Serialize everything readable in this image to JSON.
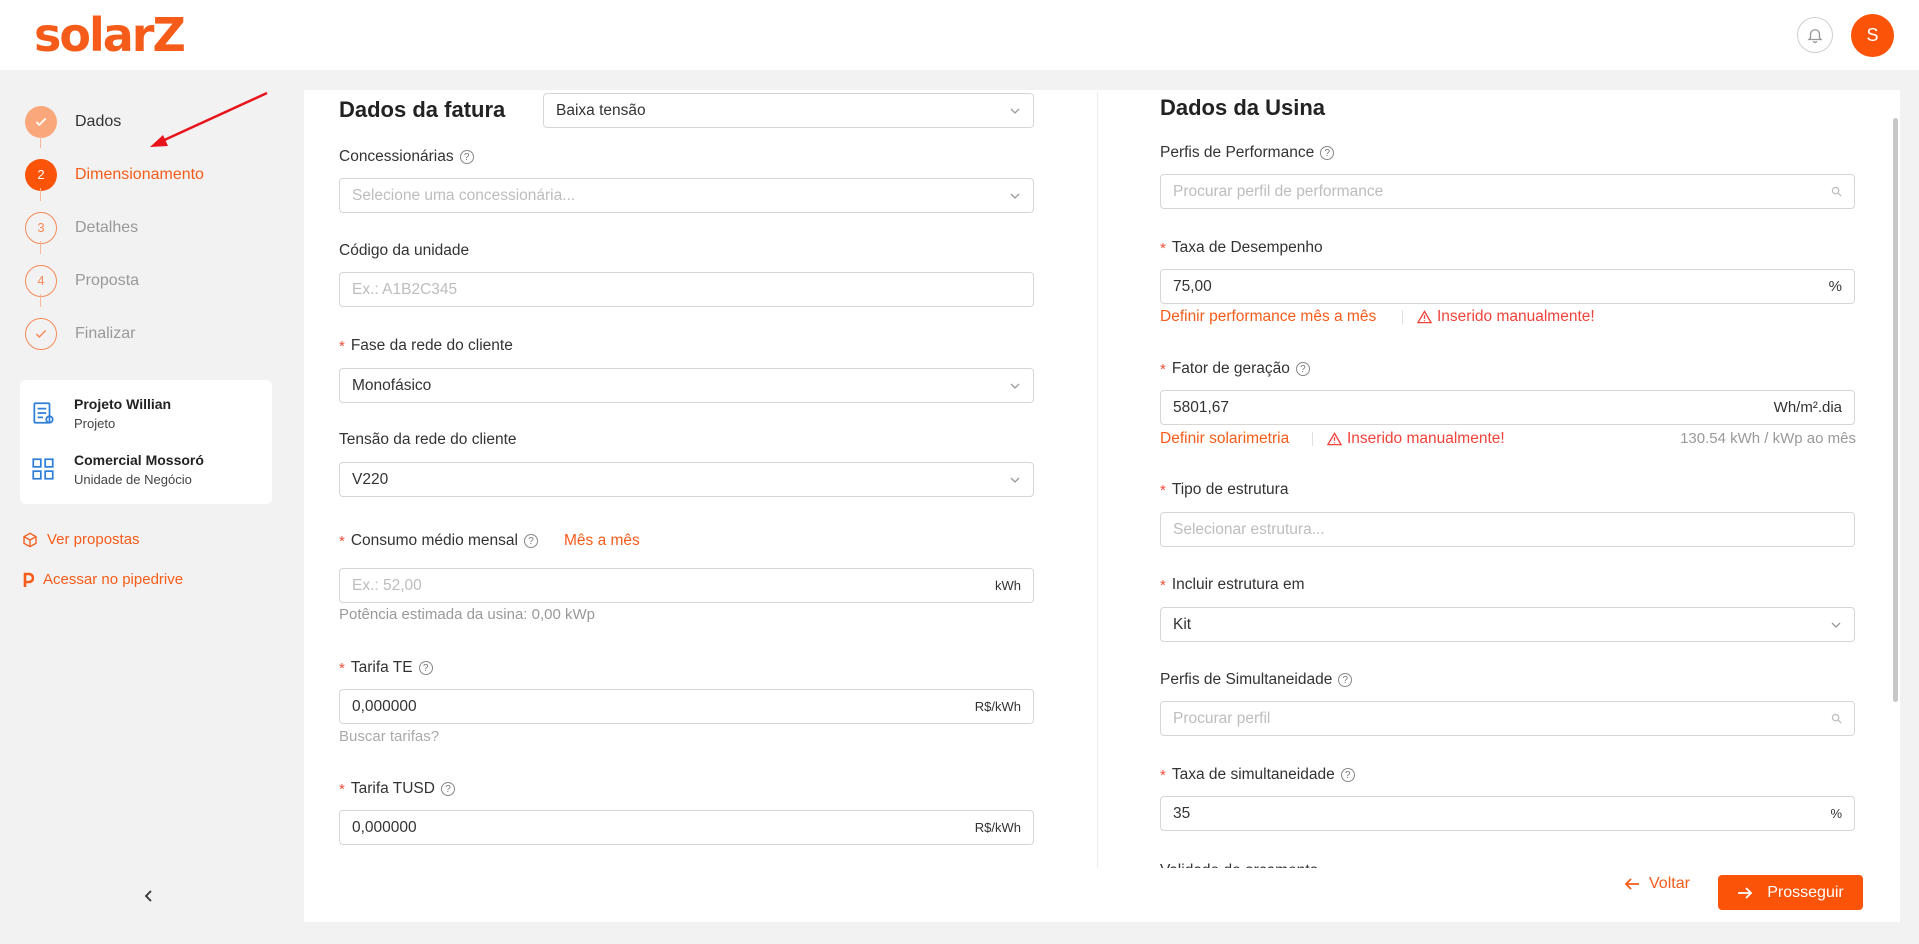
{
  "header": {
    "logo": "solarZ",
    "avatar_initial": "S"
  },
  "steps": [
    {
      "label": "Dados",
      "marker": "",
      "state": "done"
    },
    {
      "label": "Dimensionamento",
      "marker": "2",
      "state": "active"
    },
    {
      "label": "Detalhes",
      "marker": "3",
      "state": "todo"
    },
    {
      "label": "Proposta",
      "marker": "4",
      "state": "todo"
    },
    {
      "label": "Finalizar",
      "marker": "",
      "state": "todo-check"
    }
  ],
  "project_card": {
    "project_name": "Projeto Willian",
    "project_type": "Projeto",
    "business_name": "Comercial Mossoró",
    "business_type": "Unidade de Negócio"
  },
  "side_links": {
    "view_proposals": "Ver propostas",
    "pipedrive": "Acessar no pipedrive"
  },
  "invoice": {
    "title": "Dados da fatura",
    "voltage_select": "Baixa tensão",
    "utility_label": "Concessionárias",
    "utility_placeholder": "Selecione uma concessionária...",
    "unit_code_label": "Código da unidade",
    "unit_code_placeholder": "Ex.: A1B2C345",
    "phase_label": "Fase da rede do cliente",
    "phase_value": "Monofásico",
    "voltage_label": "Tensão da rede do cliente",
    "voltage_value": "V220",
    "consumption_label": "Consumo médio mensal",
    "consumption_link": "Mês a mês",
    "consumption_placeholder": "Ex.: 52,00",
    "consumption_unit": "kWh",
    "estimated_power": "Potência estimada da usina: 0,00 kWp",
    "te_label": "Tarifa TE",
    "te_value": "0,000000",
    "te_unit": "R$/kWh",
    "search_tariffs": "Buscar tarifas?",
    "tusd_label": "Tarifa TUSD",
    "tusd_value": "0,000000",
    "tusd_unit": "R$/kWh"
  },
  "plant": {
    "title": "Dados da Usina",
    "perf_profiles_label": "Perfis de Performance",
    "perf_profiles_placeholder": "Procurar perfil de performance",
    "perf_rate_label": "Taxa de Desempenho",
    "perf_rate_value": "75,00",
    "perf_rate_unit": "%",
    "perf_monthly_link": "Definir performance mês a mês",
    "manual_warning": "Inserido manualmente!",
    "gen_factor_label": "Fator de geração",
    "gen_factor_value": "5801,67",
    "gen_factor_unit": "Wh/m².dia",
    "solarimetry_link": "Definir solarimetria",
    "monthly_yield": "130.54 kWh / kWp ao mês",
    "structure_label": "Tipo de estrutura",
    "structure_placeholder": "Selecionar estrutura...",
    "include_structure_label": "Incluir estrutura em",
    "include_structure_value": "Kit",
    "simult_profiles_label": "Perfis de Simultaneidade",
    "simult_profiles_placeholder": "Procurar perfil",
    "simult_rate_label": "Taxa de simultaneidade",
    "simult_rate_value": "35",
    "simult_rate_unit": "%",
    "cut_label": "Validade do orçamento"
  },
  "footer": {
    "back": "Voltar",
    "next": "Prosseguir"
  },
  "colors": {
    "brand": "#fb5408",
    "warning": "#f0433a"
  }
}
